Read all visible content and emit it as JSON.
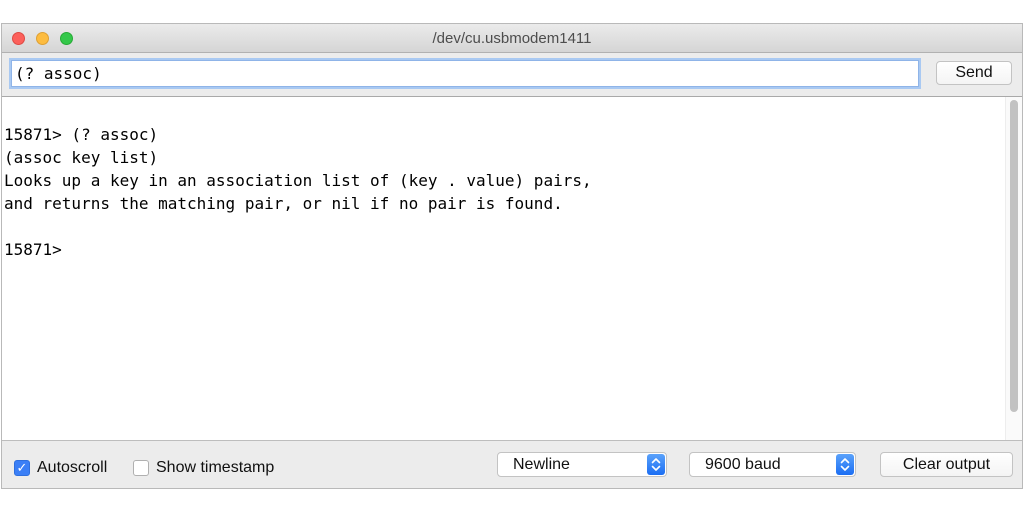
{
  "window": {
    "title": "/dev/cu.usbmodem1411"
  },
  "input": {
    "value": "(? assoc)"
  },
  "send_button": {
    "label": "Send"
  },
  "output": {
    "text": "\n15871> (? assoc)\n(assoc key list)\nLooks up a key in an association list of (key . value) pairs,\nand returns the matching pair, or nil if no pair is found.\n\n15871>"
  },
  "footer": {
    "autoscroll": {
      "label": "Autoscroll",
      "checked": true
    },
    "show_timestamp": {
      "label": "Show timestamp",
      "checked": false
    },
    "line_ending": {
      "selected": "Newline"
    },
    "baud_rate": {
      "selected": "9600 baud"
    },
    "clear_output_label": "Clear output"
  },
  "icons": {
    "close": "close-traffic-light",
    "minimize": "minimize-traffic-light",
    "zoom": "zoom-traffic-light",
    "checkmark": "checkmark-icon",
    "select_arrows": "up-down-chevron-icon"
  },
  "colors": {
    "accent": "#3b7ff6",
    "traffic_red": "#fc605b",
    "traffic_yellow": "#fdbc40",
    "traffic_green": "#34c84a"
  }
}
